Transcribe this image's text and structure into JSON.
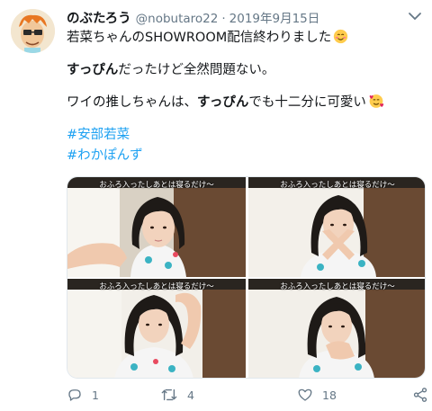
{
  "tweet": {
    "author_name": "のぶたろう",
    "author_handle": "@nobutaro22",
    "separator": "·",
    "date": "2019年9月15日",
    "lines": {
      "l1": "若菜ちゃんのSHOWROOM配信終わりました",
      "l2_bold": "すっぴん",
      "l2_rest": "だったけど全然問題ない。",
      "l3_pre": "ワイの推しちゃんは、",
      "l3_bold": "すっぴん",
      "l3_post": "でも十二分に可愛い"
    },
    "hashtags": [
      "#安部若菜",
      "#わかぽんず"
    ]
  },
  "media": {
    "captions": [
      "おふろ入ったしあとは寝るだけ〜",
      "おふろ入ったしあとは寝るだけ〜",
      "おふろ入ったしあとは寝るだけ〜",
      "おふろ入ったしあとは寝るだけ〜"
    ]
  },
  "actions": {
    "reply_count": "1",
    "retweet_count": "4",
    "like_count": "18"
  },
  "icons": {
    "caret": "chevron-down-icon",
    "reply": "reply-icon",
    "retweet": "retweet-icon",
    "like": "heart-icon",
    "share": "share-icon",
    "emoji1": "smiling-face-emoji",
    "emoji2": "smiling-face-with-hearts-emoji"
  },
  "colors": {
    "hashtag": "#1da1f2",
    "secondary_text": "#657786"
  }
}
